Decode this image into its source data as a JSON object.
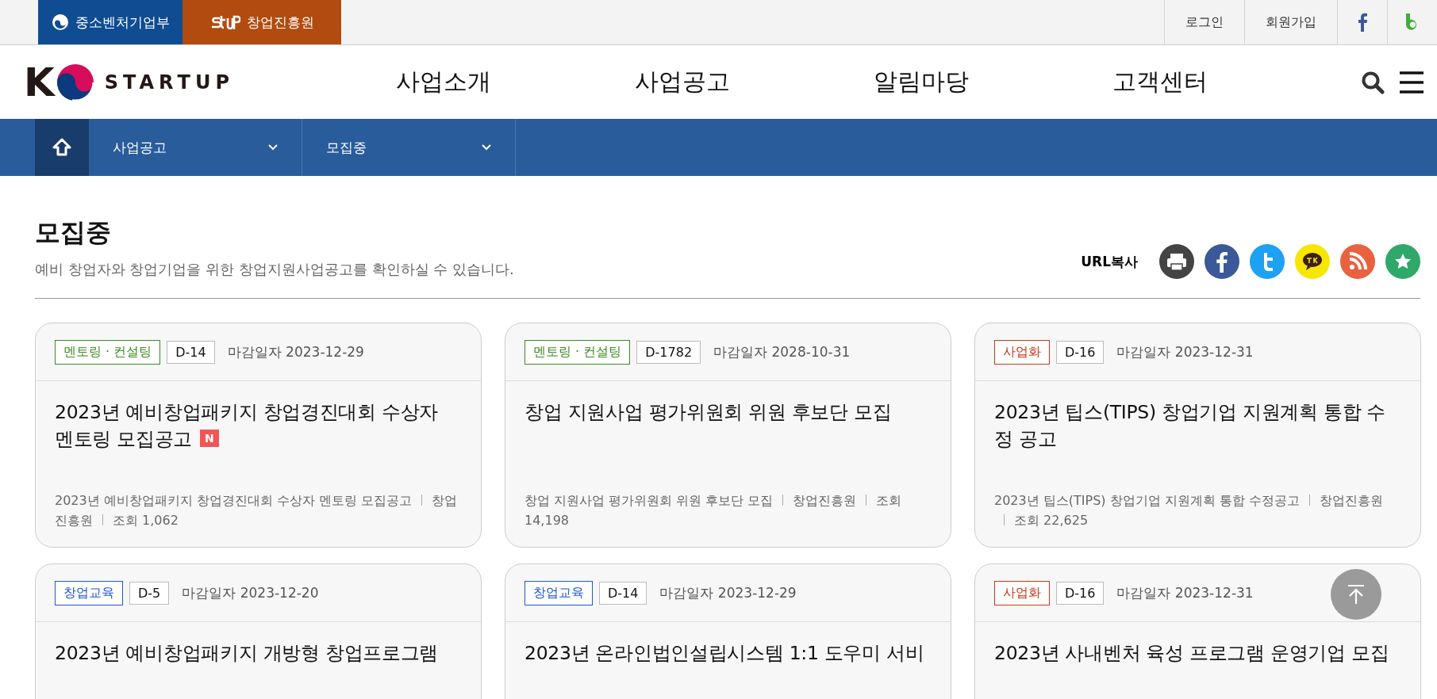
{
  "top_bar": {
    "agencies": [
      {
        "kind": "ministry",
        "label": "중소벤처기업부"
      },
      {
        "kind": "agency",
        "label": "창업진흥원"
      }
    ],
    "links": [
      "로그인",
      "회원가입"
    ],
    "social": [
      {
        "kind": "facebook"
      },
      {
        "kind": "blog"
      }
    ]
  },
  "header": {
    "logo_letter": "K",
    "logo_word": "STARTUP",
    "nav": [
      "사업소개",
      "사업공고",
      "알림마당",
      "고객센터"
    ]
  },
  "breadcrumb": {
    "items": [
      "사업공고",
      "모집중"
    ]
  },
  "page": {
    "title": "모집중",
    "subtitle": "예비 창업자와 창업기업을 위한 창업지원사업공고를 확인하실 수 있습니다.",
    "share_label": "URL복사",
    "share": [
      {
        "kind": "print",
        "color": "#444444"
      },
      {
        "kind": "facebook",
        "color": "#3b5998"
      },
      {
        "kind": "twitter",
        "color": "#1da1f2"
      },
      {
        "kind": "kakao",
        "color": "#f7e600"
      },
      {
        "kind": "rss",
        "color": "#e8623f"
      },
      {
        "kind": "star",
        "color": "#2fa86a"
      }
    ]
  },
  "cards": [
    {
      "tag": "멘토링 · 컨설팅",
      "color": "#3a8a1f",
      "dday": "D-14",
      "deadline": "마감일자 2023-12-29",
      "title": "2023년 예비창업패키지 창업경진대회 수상자 멘토링 모집공고",
      "new": true,
      "new_label": "N",
      "summary": "2023년 예비창업패키지 창업경진대회 수상자 멘토링 모집공고",
      "org": "창업진흥원",
      "views": "조회 1,062"
    },
    {
      "tag": "멘토링 · 컨설팅",
      "color": "#3a8a1f",
      "dday": "D-1782",
      "deadline": "마감일자 2028-10-31",
      "title": "창업 지원사업 평가위원회 위원 후보단 모집",
      "new": false,
      "summary": "창업 지원사업 평가위원회 위원 후보단 모집",
      "org": "창업진흥원",
      "views": "조회 14,198"
    },
    {
      "tag": "사업화",
      "color": "#c4391a",
      "dday": "D-16",
      "deadline": "마감일자 2023-12-31",
      "title": "2023년 팁스(TIPS) 창업기업 지원계획 통합 수정 공고",
      "new": false,
      "summary": "2023년 팁스(TIPS) 창업기업 지원계획 통합 수정공고",
      "org": "창업진흥원",
      "views": "조회 22,625"
    },
    {
      "tag": "창업교육",
      "color": "#2255d4",
      "dday": "D-5",
      "deadline": "마감일자 2023-12-20",
      "title": "2023년 예비창업패키지 개방형 창업프로그램",
      "new": false
    },
    {
      "tag": "창업교육",
      "color": "#2255d4",
      "dday": "D-14",
      "deadline": "마감일자 2023-12-29",
      "title": "2023년 온라인법인설립시스템 1:1 도우미 서비",
      "new": false
    },
    {
      "tag": "사업화",
      "color": "#c4391a",
      "dday": "D-16",
      "deadline": "마감일자 2023-12-31",
      "title": "2023년 사내벤처 육성 프로그램 운영기업 모집",
      "new": false
    }
  ]
}
